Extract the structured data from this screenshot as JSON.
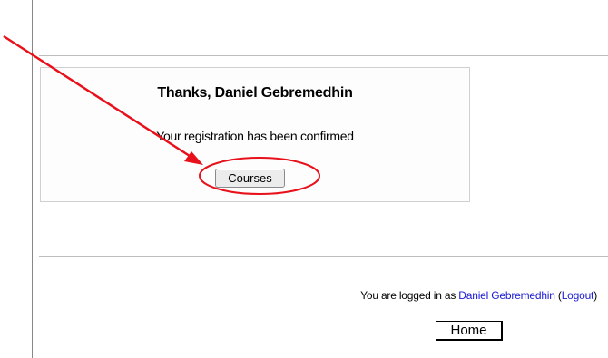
{
  "confirmation": {
    "title": "Thanks, Daniel Gebremedhin",
    "message": "Your registration has been confirmed",
    "courses_button": "Courses"
  },
  "footer": {
    "logged_in_prefix": "You are logged in as",
    "user_name": "Daniel Gebremedhin",
    "logout_open": "(",
    "logout_label": "Logout",
    "logout_close": ")",
    "home_button": "Home"
  },
  "annotation": {
    "color": "#e8101a",
    "arrow_icon": "red-arrow",
    "highlight_icon": "red-ellipse"
  }
}
